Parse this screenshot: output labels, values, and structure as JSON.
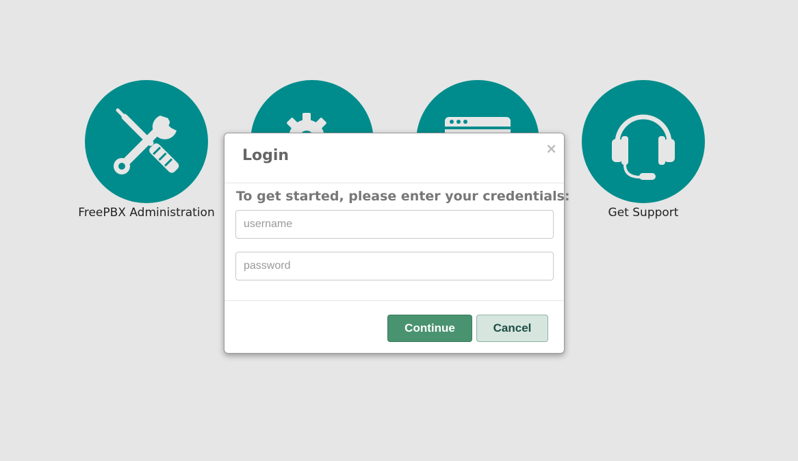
{
  "tiles": [
    {
      "label": "FreePBX Administration",
      "icon": "wrench-screwdriver-icon"
    },
    {
      "label": "",
      "icon": "gears-icon"
    },
    {
      "label": "",
      "icon": "dashboard-window-icon"
    },
    {
      "label": "Get Support",
      "icon": "headset-icon"
    }
  ],
  "modal": {
    "title": "Login",
    "close_symbol": "×",
    "intro": "To get started, please enter your credentials:",
    "username_placeholder": "username",
    "password_placeholder": "password",
    "continue_label": "Continue",
    "cancel_label": "Cancel"
  },
  "colors": {
    "background": "#e6e6e6",
    "tile_teal": "#008c8c",
    "continue_green": "#4a9370",
    "cancel_bg": "#d6e6df"
  }
}
